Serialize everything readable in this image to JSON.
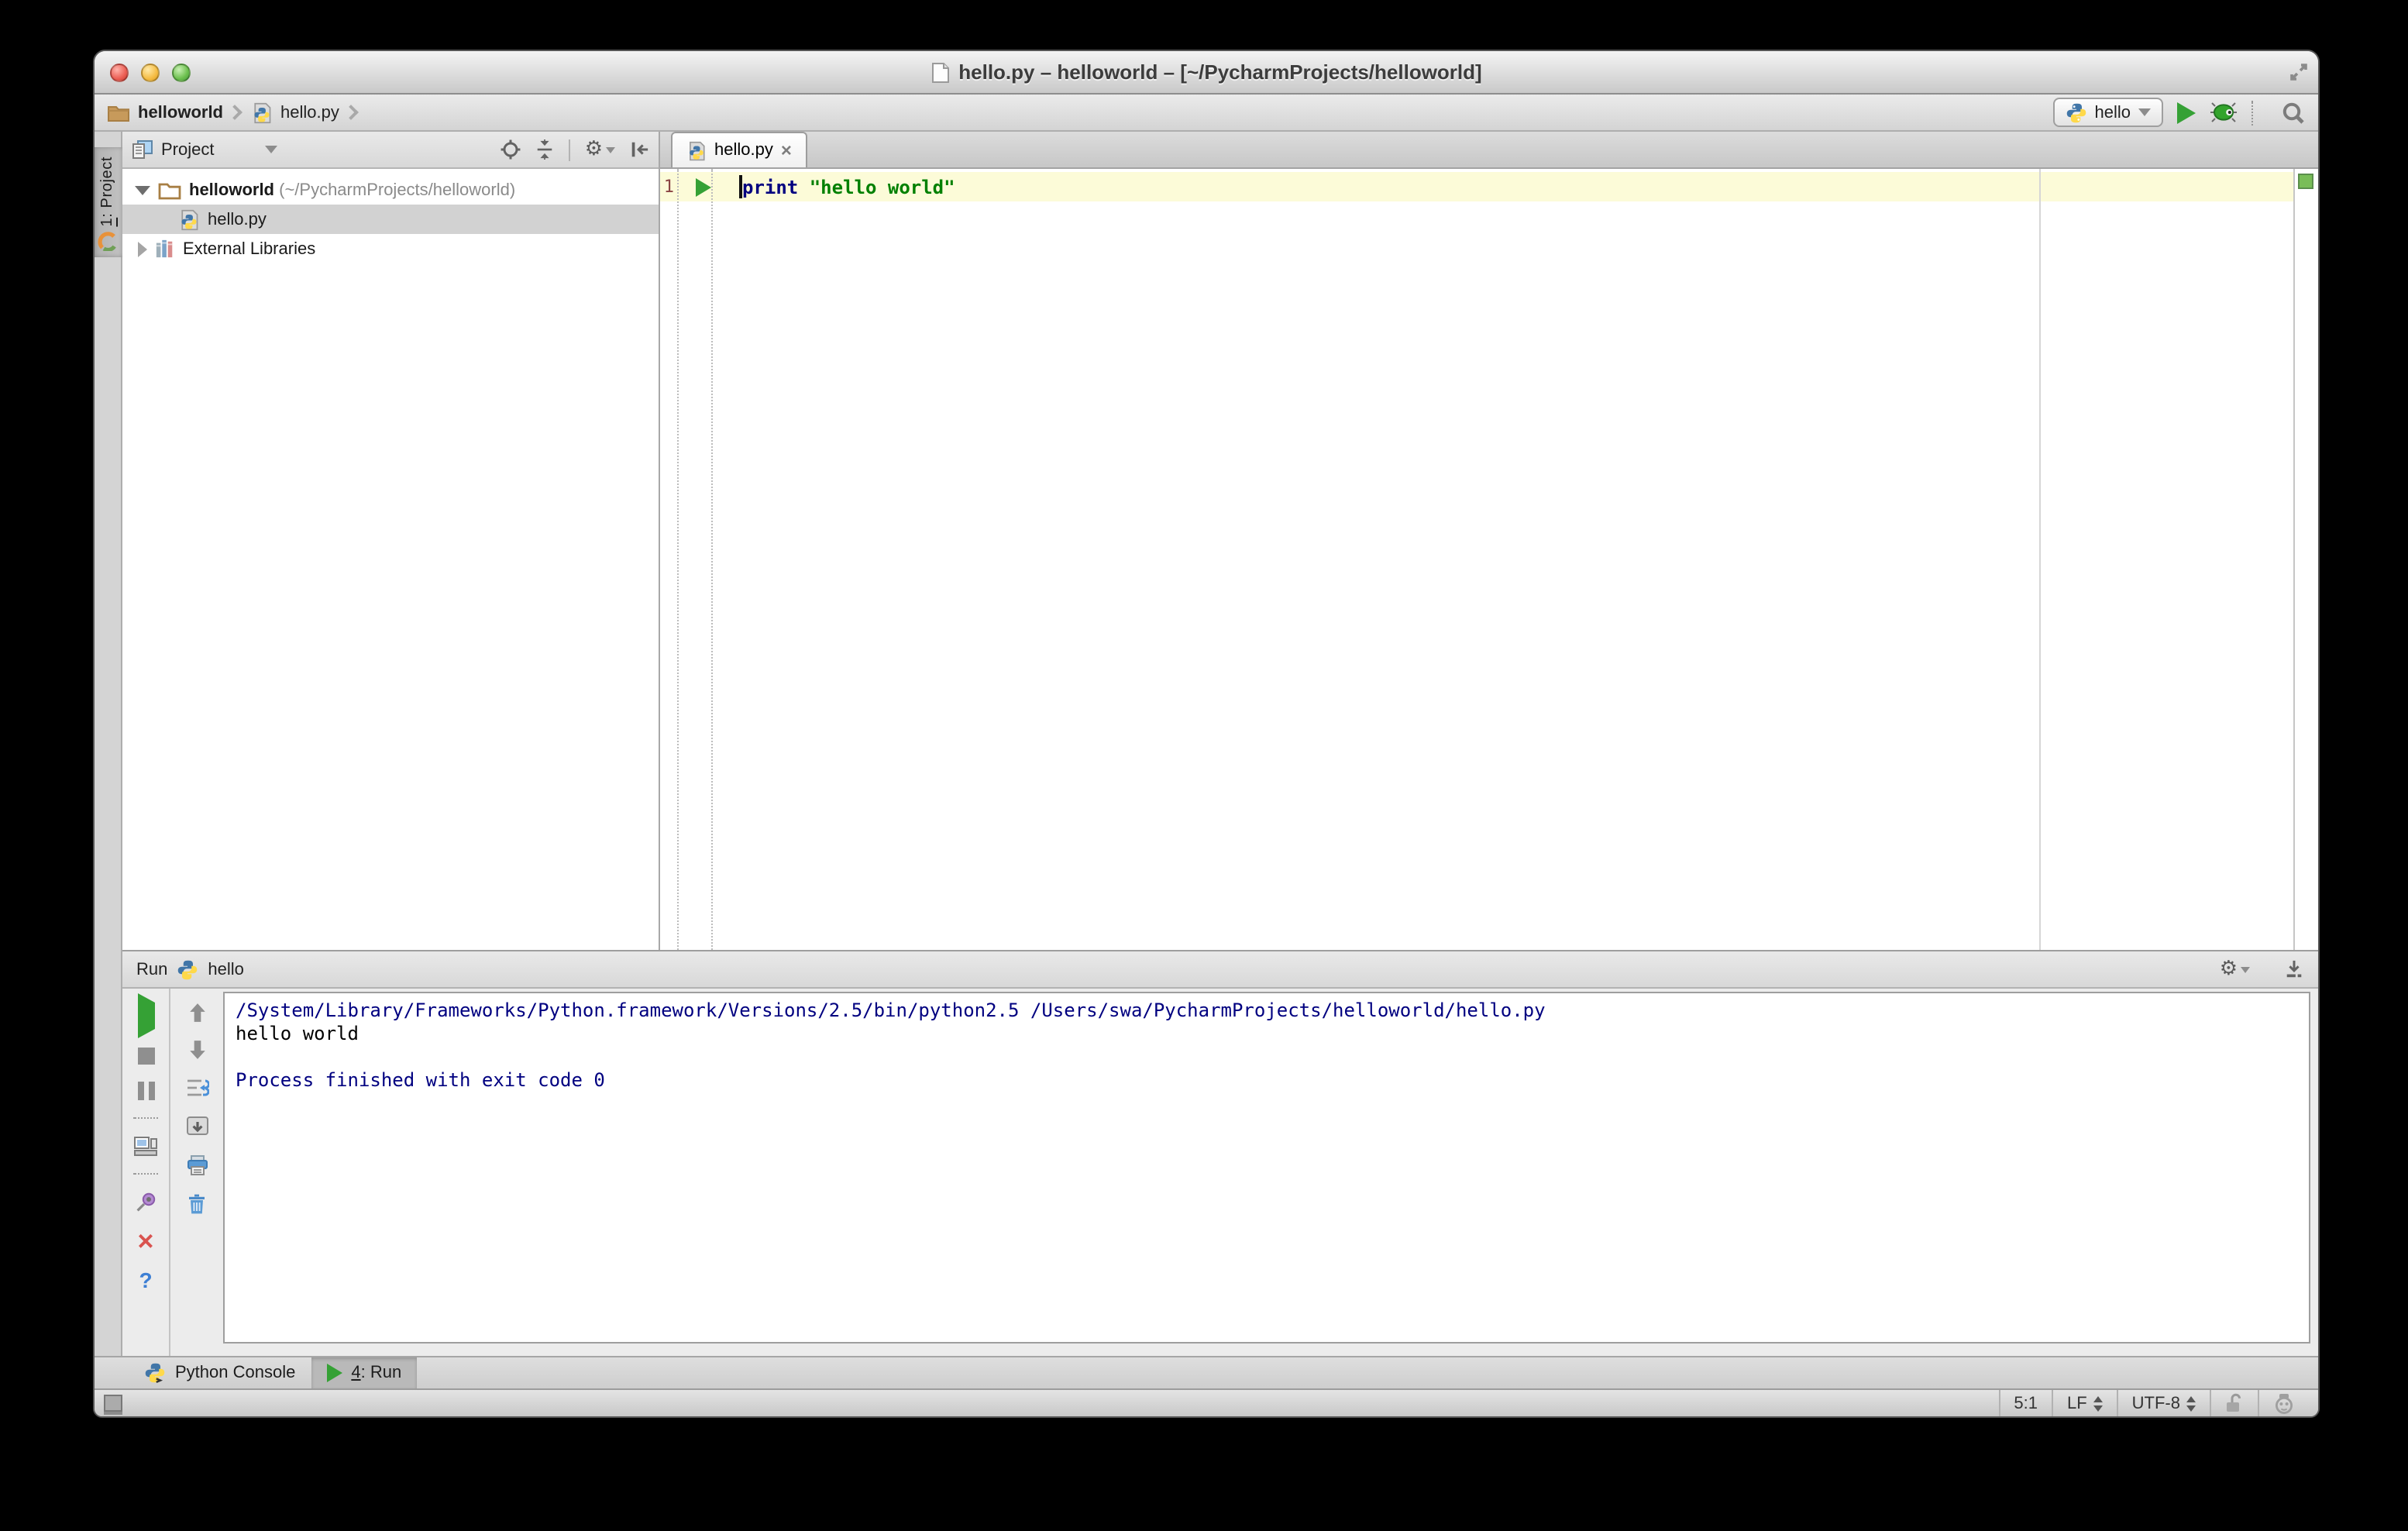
{
  "window": {
    "title": "hello.py – helloworld – [~/PycharmProjects/helloworld]"
  },
  "navbar": {
    "breadcrumbs": [
      {
        "label": "helloworld"
      },
      {
        "label": "hello.py"
      }
    ],
    "run_config_label": "hello"
  },
  "tool_stripe": {
    "project_num": "1",
    "project_rest": ": Project"
  },
  "project_panel": {
    "header_label": "Project",
    "tree": [
      {
        "name": "helloworld",
        "path": " (~/PycharmProjects/helloworld)"
      },
      {
        "name": "hello.py"
      },
      {
        "name": "External Libraries"
      }
    ]
  },
  "editor": {
    "tab_label": "hello.py",
    "tab_close": "×",
    "line_number": "1",
    "code_keyword": "print",
    "code_string": "\"hello world\""
  },
  "run_panel": {
    "title": "Run",
    "config_label": "hello",
    "console_lines": [
      {
        "text": "/System/Library/Frameworks/Python.framework/Versions/2.5/bin/python2.5 /Users/swa/PycharmProjects/helloworld/hello.py"
      },
      {
        "text": "hello world"
      },
      {
        "text": " "
      },
      {
        "text": "Process finished with exit code 0"
      }
    ],
    "toolbar": {
      "close_glyph": "✕",
      "help_glyph": "?"
    }
  },
  "bottom_bar": {
    "python_console_label": "Python Console",
    "run_tab_num": "4",
    "run_tab_rest": ": Run"
  },
  "status_bar": {
    "caret_position": "5:1",
    "line_separator": "LF",
    "encoding": "UTF-8"
  },
  "icons": {
    "gear_glyph": "⚙"
  },
  "colors": {
    "run_green": "#35a135",
    "keyword_blue": "#000080",
    "string_green": "#008000",
    "console_system_blue": "#000080",
    "current_line_bg": "#fcfbd8",
    "inspection_ok_green": "#79bd58"
  }
}
